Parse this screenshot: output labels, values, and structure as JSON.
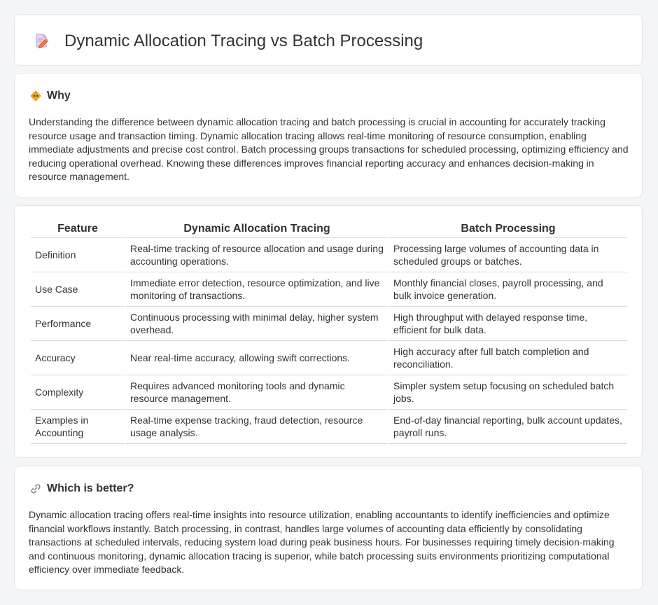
{
  "page": {
    "title": "Dynamic Allocation Tracing vs Batch Processing",
    "title_icon": "pencil-document-icon"
  },
  "why": {
    "heading": "Why",
    "icon": "warning-diamond-icon",
    "text": "Understanding the difference between dynamic allocation tracing and batch processing is crucial in accounting for accurately tracking resource usage and transaction timing. Dynamic allocation tracing allows real-time monitoring of resource consumption, enabling immediate adjustments and precise cost control. Batch processing groups transactions for scheduled processing, optimizing efficiency and reducing operational overhead. Knowing these differences improves financial reporting accuracy and enhances decision-making in resource management."
  },
  "table": {
    "headers": [
      "Feature",
      "Dynamic Allocation Tracing",
      "Batch Processing"
    ],
    "rows": [
      [
        "Definition",
        "Real-time tracking of resource allocation and usage during accounting operations.",
        "Processing large volumes of accounting data in scheduled groups or batches."
      ],
      [
        "Use Case",
        "Immediate error detection, resource optimization, and live monitoring of transactions.",
        "Monthly financial closes, payroll processing, and bulk invoice generation."
      ],
      [
        "Performance",
        "Continuous processing with minimal delay, higher system overhead.",
        "High throughput with delayed response time, efficient for bulk data."
      ],
      [
        "Accuracy",
        "Near real-time accuracy, allowing swift corrections.",
        "High accuracy after full batch completion and reconciliation."
      ],
      [
        "Complexity",
        "Requires advanced monitoring tools and dynamic resource management.",
        "Simpler system setup focusing on scheduled batch jobs."
      ],
      [
        "Examples in Accounting",
        "Real-time expense tracking, fraud detection, resource usage analysis.",
        "End-of-day financial reporting, bulk account updates, payroll runs."
      ]
    ]
  },
  "better": {
    "heading": "Which is better?",
    "icon": "link-icon",
    "text": "Dynamic allocation tracing offers real-time insights into resource utilization, enabling accountants to identify inefficiencies and optimize financial workflows instantly. Batch processing, in contrast, handles large volumes of accounting data efficiently by consolidating transactions at scheduled intervals, reducing system load during peak business hours. For businesses requiring timely decision-making and continuous monitoring, dynamic allocation tracing is superior, while batch processing suits environments prioritizing computational efficiency over immediate feedback."
  },
  "colors": {
    "background": "#f4f5f7",
    "card": "#ffffff",
    "border": "#e3e5e8",
    "text": "#333333"
  }
}
